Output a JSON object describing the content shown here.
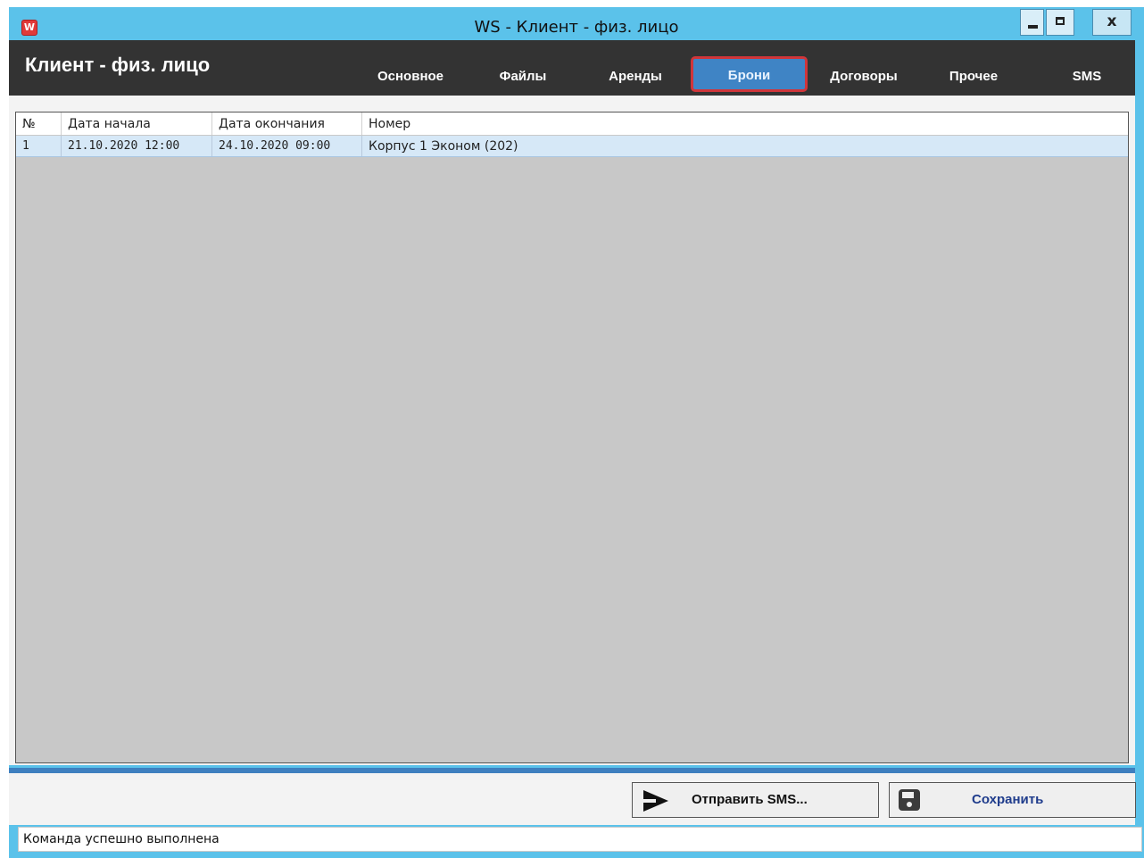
{
  "window": {
    "title": "WS - Клиент - физ. лицо",
    "app_icon_letter": "W",
    "min_label": "",
    "max_label": "",
    "close_label": "x"
  },
  "header": {
    "title": "Клиент - физ. лицо",
    "tabs": [
      {
        "label": "Основное",
        "active": false
      },
      {
        "label": "Файлы",
        "active": false
      },
      {
        "label": "Аренды",
        "active": false
      },
      {
        "label": "Брони",
        "active": true
      },
      {
        "label": "Договоры",
        "active": false
      },
      {
        "label": "Прочее",
        "active": false
      },
      {
        "label": "SMS",
        "active": false
      }
    ]
  },
  "grid": {
    "columns": [
      "№",
      "Дата начала",
      "Дата окончания",
      "Номер"
    ],
    "rows": [
      {
        "num": "1",
        "start": "21.10.2020 12:00",
        "end": "24.10.2020 09:00",
        "room": "Корпус 1 Эконом (202)"
      }
    ]
  },
  "buttons": {
    "send_sms": "Отправить SMS...",
    "save": "Сохранить"
  },
  "status": "Команда успешно выполнена",
  "colors": {
    "titlebar": "#5bc2ea",
    "header": "#333333",
    "active_tab": "#3f84c5",
    "active_tab_border": "#d0353a",
    "grid_bg": "#c8c8c8",
    "selected_row": "#d6e8f7"
  },
  "icons": {
    "app": "app-logo-icon",
    "send": "send-arrow-icon",
    "save": "floppy-disk-icon"
  }
}
